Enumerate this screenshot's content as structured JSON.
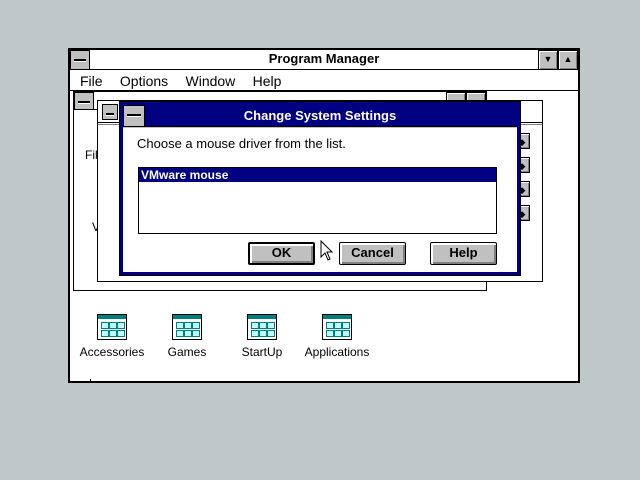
{
  "program_manager": {
    "title": "Program Manager",
    "menu": [
      "File",
      "Options",
      "Window",
      "Help"
    ],
    "minimize_glyph": "▼",
    "maximize_glyph": "▲"
  },
  "background_window": {
    "partial_menu_text": "Fil",
    "partial_text": "V"
  },
  "groups": [
    {
      "label": "Accessories",
      "icon": "program-group-icon"
    },
    {
      "label": "Games",
      "icon": "program-group-icon"
    },
    {
      "label": "StartUp",
      "icon": "program-group-icon"
    },
    {
      "label": "Applications",
      "icon": "program-group-icon"
    }
  ],
  "dialog": {
    "title": "Change System Settings",
    "prompt": "Choose a mouse driver from the list.",
    "list_items": [
      "VMware mouse"
    ],
    "selected_index": 0,
    "buttons": {
      "ok": "OK",
      "cancel": "Cancel",
      "help": "Help"
    }
  },
  "colors": {
    "desktop": "#c0c7c8",
    "active_title": "#000080",
    "selection": "#000080"
  }
}
